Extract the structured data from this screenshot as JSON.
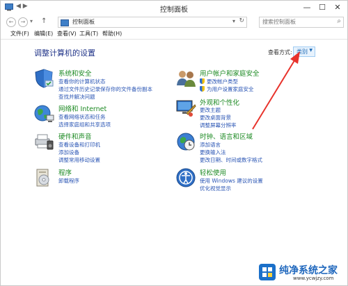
{
  "window": {
    "title": "控制面板",
    "qat_glyphs": "◀ ▶",
    "controls": {
      "minimize": "—",
      "maximize": "☐",
      "close": "✕"
    }
  },
  "address": {
    "back_glyph": "←",
    "forward_glyph": "→",
    "recent_glyph": "▾",
    "up_glyph": "↑",
    "breadcrumb": "控制面板",
    "dropdown_glyph": "▾",
    "refresh_glyph": "↻",
    "search_placeholder": "搜索控制面板",
    "search_glyph": "⌕"
  },
  "menu": [
    "文件(F)",
    "编辑(E)",
    "查看(V)",
    "工具(T)",
    "帮助(H)"
  ],
  "main": {
    "heading": "调整计算机的设置",
    "view_by_label": "查看方式:",
    "view_by_value": "类别",
    "categories_left": [
      {
        "title": "系统和安全",
        "icon": "system-security-icon",
        "links": [
          "查看你的计算机状态",
          "通过文件历史记录保存你的文件备份副本",
          "查找并解决问题"
        ]
      },
      {
        "title": "网络和 Internet",
        "icon": "network-internet-icon",
        "links": [
          "查看网络状态和任务",
          "选择家庭组和共享选项"
        ]
      },
      {
        "title": "硬件和声音",
        "icon": "hardware-sound-icon",
        "links": [
          "查看设备和打印机",
          "添加设备",
          "调整常用移动设置"
        ]
      },
      {
        "title": "程序",
        "icon": "programs-icon",
        "links": [
          "卸载程序"
        ]
      }
    ],
    "categories_right": [
      {
        "title": "用户帐户和家庭安全",
        "icon": "user-accounts-icon",
        "links": [
          "更改帐户类型",
          "为用户设置家庭安全"
        ]
      },
      {
        "title": "外观和个性化",
        "icon": "appearance-icon",
        "links": [
          "更改主题",
          "更改桌面背景",
          "调整屏幕分辨率"
        ]
      },
      {
        "title": "时钟、语言和区域",
        "icon": "clock-language-icon",
        "links": [
          "添加语言",
          "更换输入法",
          "更改日期、时间或数字格式"
        ]
      },
      {
        "title": "轻松使用",
        "icon": "ease-of-access-icon",
        "links": [
          "使用 Windows 建议的设置",
          "优化视觉显示"
        ]
      }
    ]
  },
  "watermark": {
    "text": "纯净系统之家",
    "url": "www.ycwjzy.com"
  },
  "colors": {
    "heading": "#1e3287",
    "category_title": "#1d8a23",
    "link": "#2a55b4",
    "annotation_arrow": "#e8322b"
  }
}
